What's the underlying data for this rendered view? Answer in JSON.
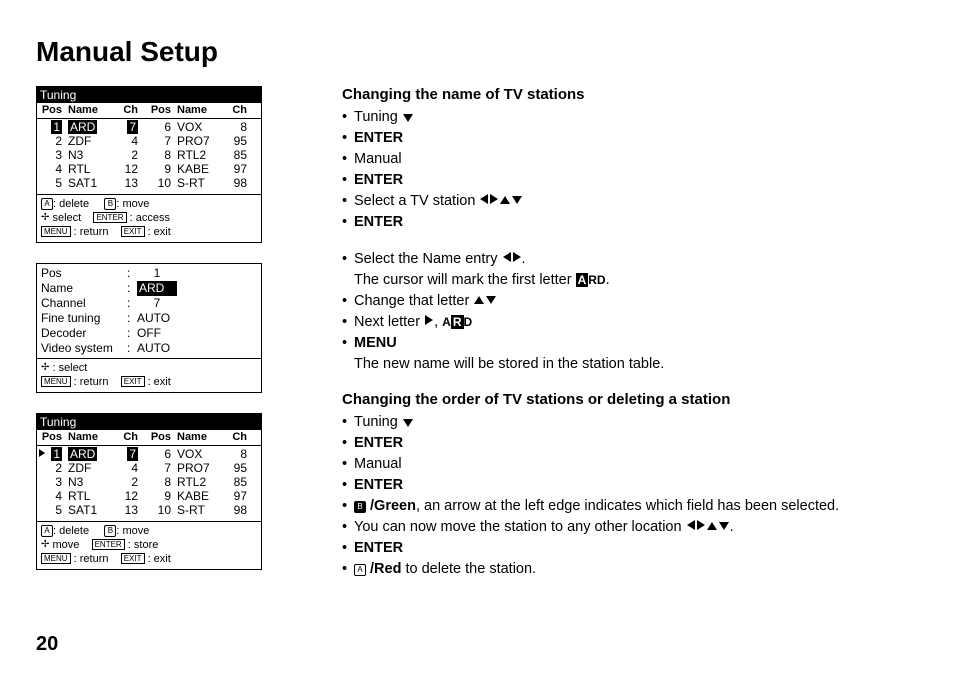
{
  "page_number": "20",
  "title": "Manual Setup",
  "panel_headers": {
    "pos": "Pos",
    "name": "Name",
    "ch": "Ch"
  },
  "stations_left": [
    {
      "pos": "1",
      "name": "ARD",
      "ch": "7"
    },
    {
      "pos": "2",
      "name": "ZDF",
      "ch": "4"
    },
    {
      "pos": "3",
      "name": "N3",
      "ch": "2"
    },
    {
      "pos": "4",
      "name": "RTL",
      "ch": "12"
    },
    {
      "pos": "5",
      "name": "SAT1",
      "ch": "13"
    }
  ],
  "stations_right": [
    {
      "pos": "6",
      "name": "VOX",
      "ch": "8"
    },
    {
      "pos": "7",
      "name": "PRO7",
      "ch": "95"
    },
    {
      "pos": "8",
      "name": "RTL2",
      "ch": "85"
    },
    {
      "pos": "9",
      "name": "KABE",
      "ch": "97"
    },
    {
      "pos": "10",
      "name": "S-RT",
      "ch": "98"
    }
  ],
  "tuning_title": "Tuning",
  "legend1": {
    "a": "A",
    "a_label": ": delete",
    "b": "B",
    "b_label": ": move",
    "select_label": "select",
    "enter_key": "ENTER",
    "enter_label": ": access",
    "menu_key": "MENU",
    "menu_label": ": return",
    "exit_key": "EXIT",
    "exit_label": ": exit"
  },
  "detail": {
    "pos_l": "Pos",
    "pos_v": "1",
    "name_l": "Name",
    "name_v": "ARD",
    "channel_l": "Channel",
    "channel_v": "7",
    "finetune_l": "Fine tuning",
    "finetune_v": "AUTO",
    "decoder_l": "Decoder",
    "decoder_v": "OFF",
    "videosys_l": "Video system",
    "videosys_v": "AUTO"
  },
  "legend2": {
    "select_label": ": select",
    "menu_key": "MENU",
    "menu_label": ": return",
    "exit_key": "EXIT",
    "exit_label": ": exit"
  },
  "legend3": {
    "a": "A",
    "a_label": ": delete",
    "b": "B",
    "b_label": ": move",
    "move_label": "move",
    "enter_key": "ENTER",
    "enter_label": ": store",
    "menu_key": "MENU",
    "menu_label": ": return",
    "exit_key": "EXIT",
    "exit_label": ": exit"
  },
  "sec1_title": "Changing the name of TV stations",
  "sec1": {
    "tuning": "Tuning",
    "enter": "ENTER",
    "manual": "Manual",
    "select_station": "Select a TV station"
  },
  "sec1b": {
    "select_name_pre": "Select the Name entry ",
    "select_name_post": ".",
    "cursor_line": "The cursor will mark the first letter ",
    "cursor_ard_a": "A",
    "cursor_ard_rest": "RD",
    "change_letter": "Change that letter ",
    "next_letter": "Next letter ",
    "next_ard_a": "A",
    "next_ard_r": "R",
    "next_ard_d": "D",
    "menu": "MENU",
    "menu_note": "The new name will be stored in the station table."
  },
  "sec2_title": "Changing the order of TV stations or deleting a station",
  "sec2": {
    "tuning": "Tuning",
    "enter": "ENTER",
    "manual": "Manual",
    "b": "B",
    "green_pre": " /Green",
    "green_rest": ", an arrow at the left edge indicates which field has been selected.",
    "move_line": "You can now move the station to any other location ",
    "a": "A",
    "red_text": " /Red",
    "red_rest": " to delete the station."
  }
}
